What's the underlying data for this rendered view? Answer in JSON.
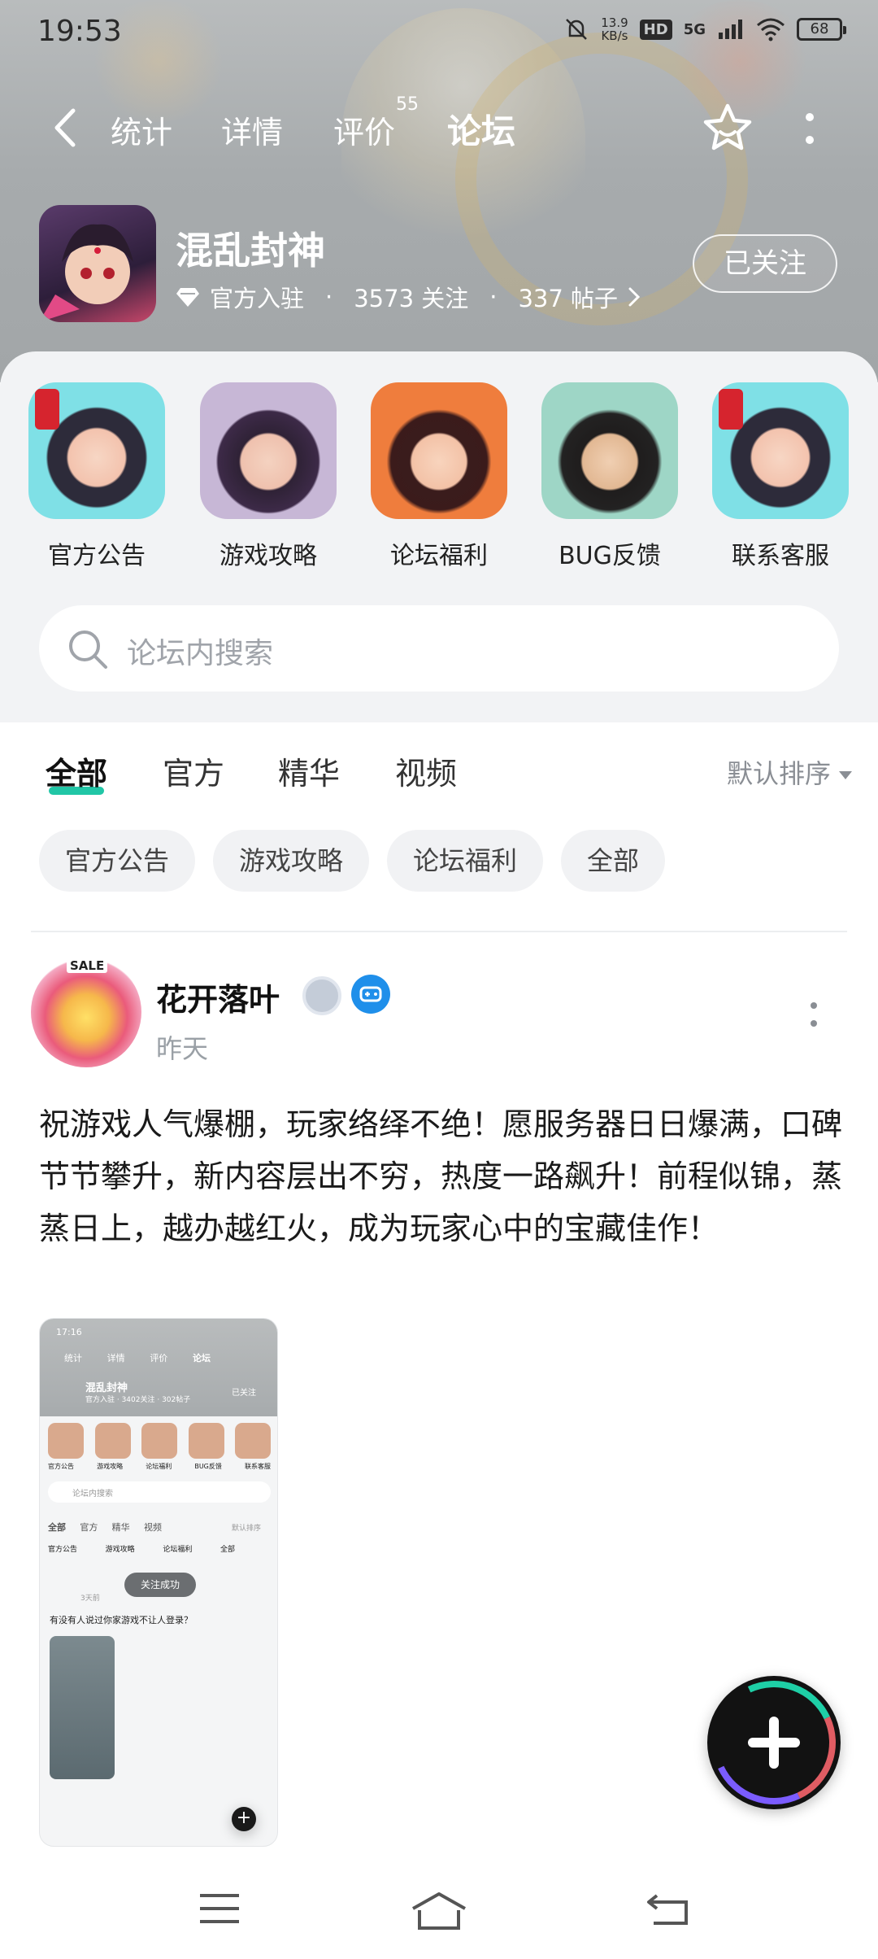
{
  "status_bar": {
    "time": "19:53",
    "net_speed": "13.9",
    "net_unit": "KB/s",
    "hd": "HD",
    "network": "5G",
    "battery": "68"
  },
  "nav": {
    "tabs": [
      {
        "label": "统计"
      },
      {
        "label": "详情"
      },
      {
        "label": "评价"
      },
      {
        "label": "论坛"
      }
    ],
    "review_count": "55",
    "active_tab": "论坛"
  },
  "game": {
    "name": "混乱封神",
    "official": "官方入驻",
    "followers": "3573 关注",
    "posts": "337 帖子",
    "follow_label": "已关注"
  },
  "shortcuts": [
    {
      "label": "官方公告"
    },
    {
      "label": "游戏攻略"
    },
    {
      "label": "论坛福利"
    },
    {
      "label": "BUG反馈"
    },
    {
      "label": "联系客服"
    }
  ],
  "search": {
    "placeholder": "论坛内搜索"
  },
  "feed_tabs": [
    {
      "label": "全部"
    },
    {
      "label": "官方"
    },
    {
      "label": "精华"
    },
    {
      "label": "视频"
    }
  ],
  "sort_label": "默认排序",
  "chips": [
    {
      "label": "官方公告"
    },
    {
      "label": "游戏攻略"
    },
    {
      "label": "论坛福利"
    },
    {
      "label": "全部"
    }
  ],
  "post": {
    "author": "花开落叶",
    "time": "昨天",
    "avatar_tag": "SALE",
    "content": "祝游戏人气爆棚，玩家络绎不绝！愿服务器日日爆满，口碑节节攀升，新内容层出不穷，热度一路飙升！前程似锦，蒸蒸日上，越办越红火，成为玩家心中的宝藏佳作！",
    "image": {
      "time": "17:16",
      "tabs": [
        "统计",
        "详情",
        "评价",
        "论坛"
      ],
      "game_name": "混乱封神",
      "game_meta": "官方入驻 · 3402关注 · 302帖子",
      "follow": "已关注",
      "shortcuts": [
        "官方公告",
        "游戏攻略",
        "论坛福利",
        "BUG反馈",
        "联系客服"
      ],
      "search": "论坛内搜索",
      "feed_tabs": [
        "全部",
        "官方",
        "精华",
        "视频"
      ],
      "sort": "默认排序",
      "chips": [
        "官方公告",
        "游戏攻略",
        "论坛福利",
        "全部"
      ],
      "post_time": "3天前",
      "toast": "关注成功",
      "post_text": "有没有人说过你家游戏不让人登录？"
    }
  },
  "colors": {
    "accent": "#21c6a6",
    "header_bg": "#a7abad",
    "panel_bg": "#f2f3f5"
  },
  "icons": {
    "back": "chevron-left-icon",
    "favorite": "star-outline-icon",
    "more": "more-vertical-icon",
    "search": "search-icon",
    "create": "plus-icon",
    "menu": "menu-icon",
    "home": "home-icon",
    "return": "return-icon"
  }
}
